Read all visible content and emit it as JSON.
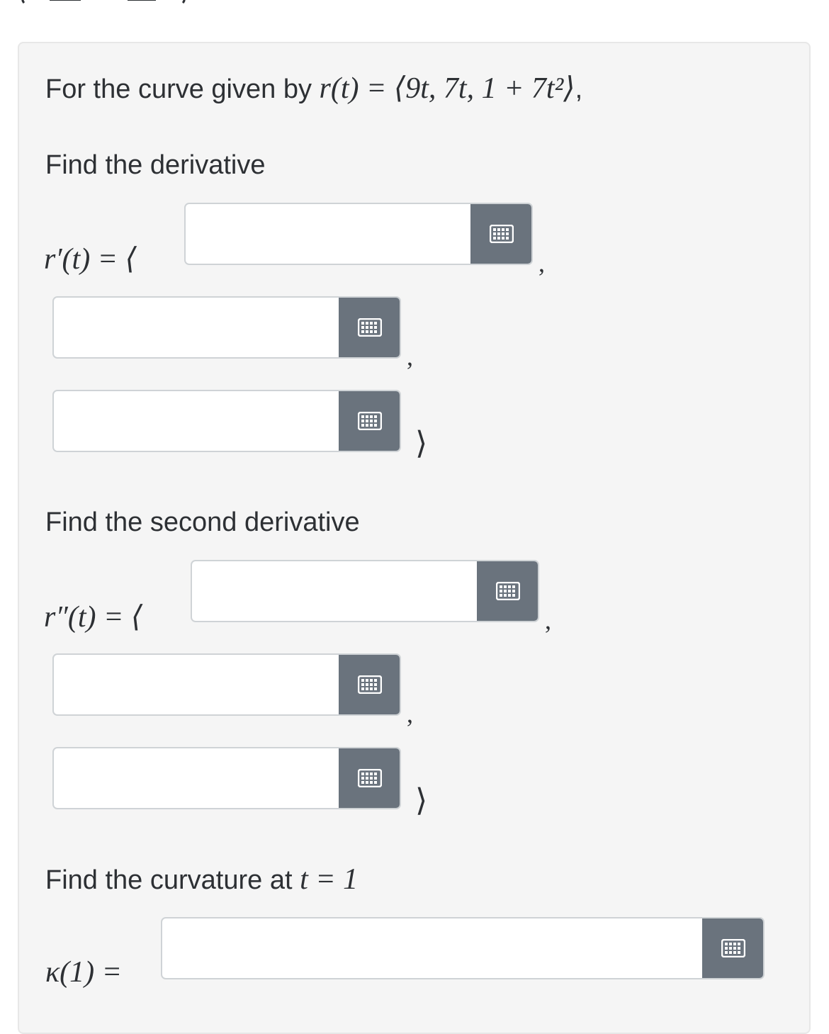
{
  "problem": {
    "intro_text": "For the curve given by ",
    "intro_math": "r(t) = ⟨9t, 7t, 1 + 7t²⟩",
    "intro_suffix": ","
  },
  "derivative": {
    "heading": "Find the derivative",
    "lhs": "r′(t) = ⟨",
    "comma1": ",",
    "comma2": ",",
    "close": "⟩",
    "inputs": [
      {
        "value": "",
        "placeholder": ""
      },
      {
        "value": "",
        "placeholder": ""
      },
      {
        "value": "",
        "placeholder": ""
      }
    ]
  },
  "second_derivative": {
    "heading": "Find the second derivative",
    "lhs": "r″(t) = ⟨",
    "comma1": ",",
    "comma2": ",",
    "close": "⟩",
    "inputs": [
      {
        "value": "",
        "placeholder": ""
      },
      {
        "value": "",
        "placeholder": ""
      },
      {
        "value": "",
        "placeholder": ""
      }
    ]
  },
  "curvature": {
    "heading_text": "Find the curvature at ",
    "heading_math": "t = 1",
    "lhs": "κ(1) =",
    "input": {
      "value": "",
      "placeholder": ""
    }
  },
  "icons": {
    "keyboard": "keyboard-icon"
  },
  "colors": {
    "panel_bg": "#f5f5f5",
    "button_bg": "#6a737d",
    "text": "#2d3034"
  }
}
